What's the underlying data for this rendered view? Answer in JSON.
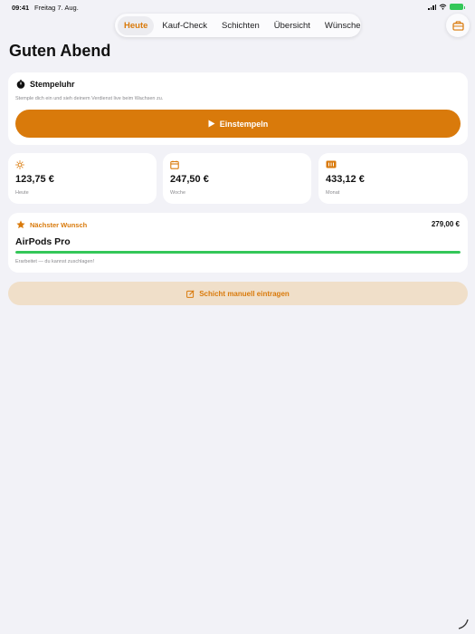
{
  "status": {
    "time": "09:41",
    "date": "Freitag 7. Aug."
  },
  "tabs": [
    {
      "label": "Heute",
      "active": true
    },
    {
      "label": "Kauf-Check",
      "active": false
    },
    {
      "label": "Schichten",
      "active": false
    },
    {
      "label": "Übersicht",
      "active": false
    },
    {
      "label": "Wünsche",
      "active": false
    }
  ],
  "header": {
    "greeting": "Guten Abend",
    "wallet_icon": "wallet-icon"
  },
  "stempeluhr": {
    "title": "Stempeluhr",
    "subtitle": "Stemple dich ein und sieh deinem Verdienst live beim Wachsen zu.",
    "button_label": "Einstempeln"
  },
  "stats": [
    {
      "icon": "sun-icon",
      "value": "123,75 €",
      "label": "Heute"
    },
    {
      "icon": "calendar-icon",
      "value": "247,50 €",
      "label": "Woche"
    },
    {
      "icon": "month-icon",
      "value": "433,12 €",
      "label": "Monat"
    }
  ],
  "wish": {
    "header": "Nächster Wunsch",
    "price": "279,00 €",
    "name": "AirPods Pro",
    "progress": 1.0,
    "note": "Erarbeitet — du kannst zuschlagen!"
  },
  "manual_button": {
    "label": "Schicht manuell eintragen"
  },
  "colors": {
    "accent": "#d97a0b",
    "success": "#34c759",
    "background": "#f2f2f7"
  }
}
